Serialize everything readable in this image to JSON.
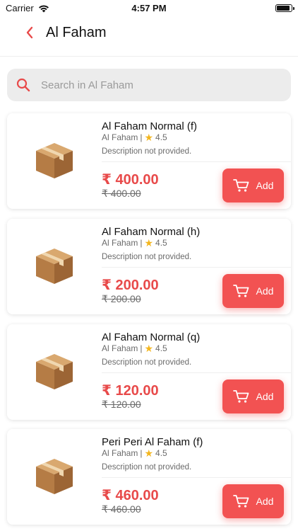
{
  "status_bar": {
    "carrier": "Carrier",
    "time": "4:57 PM"
  },
  "header": {
    "title": "Al Faham",
    "back_icon": "chevron-left-icon"
  },
  "search": {
    "placeholder": "Search in Al Faham",
    "value": ""
  },
  "colors": {
    "accent": "#f25252",
    "price": "#e84a4a",
    "star": "#f3b61f"
  },
  "products": [
    {
      "name": "Al Faham Normal (f)",
      "vendor": "Al Faham",
      "separator": "|",
      "rating": "4.5",
      "description": "Description not provided.",
      "price": "₹ 400.00",
      "old_price": "₹ 400.00",
      "add_label": "Add"
    },
    {
      "name": "Al Faham Normal (h)",
      "vendor": "Al Faham",
      "separator": "|",
      "rating": "4.5",
      "description": "Description not provided.",
      "price": "₹ 200.00",
      "old_price": "₹ 200.00",
      "add_label": "Add"
    },
    {
      "name": "Al Faham Normal (q)",
      "vendor": "Al Faham",
      "separator": "|",
      "rating": "4.5",
      "description": "Description not provided.",
      "price": "₹ 120.00",
      "old_price": "₹ 120.00",
      "add_label": "Add"
    },
    {
      "name": "Peri Peri Al Faham (f)",
      "vendor": "Al Faham",
      "separator": "|",
      "rating": "4.5",
      "description": "Description not provided.",
      "price": "₹ 460.00",
      "old_price": "₹ 460.00",
      "add_label": "Add"
    }
  ]
}
